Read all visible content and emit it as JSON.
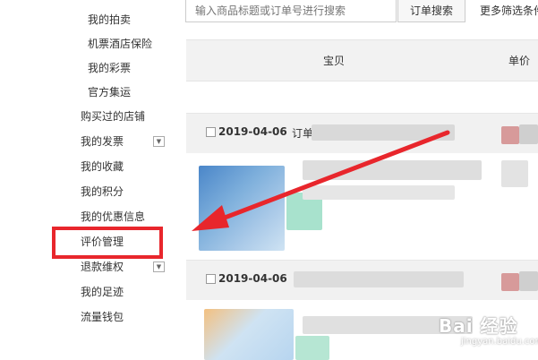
{
  "sidebar": {
    "sub_items": [
      {
        "label": "我的拍卖"
      },
      {
        "label": "机票酒店保险"
      },
      {
        "label": "我的彩票"
      },
      {
        "label": "官方集运"
      }
    ],
    "items": [
      {
        "label": "购买过的店铺"
      },
      {
        "label": "我的发票"
      },
      {
        "label": "我的收藏"
      },
      {
        "label": "我的积分"
      },
      {
        "label": "我的优惠信息"
      },
      {
        "label": "评价管理"
      },
      {
        "label": "退款维权"
      },
      {
        "label": "我的足迹"
      },
      {
        "label": "流量钱包"
      }
    ]
  },
  "search": {
    "placeholder": "输入商品标题或订单号进行搜索",
    "button_label": "订单搜索",
    "more_filters_label": "更多筛选条件"
  },
  "table_header": {
    "col_item": "宝贝",
    "col_price": "单价"
  },
  "orders": [
    {
      "date": "2019-04-06",
      "number_prefix": "订单"
    },
    {
      "date": "2019-04-06"
    }
  ],
  "watermark": {
    "brand": "Bai 经验",
    "sub": "jingyan.baidu.com"
  },
  "colors": {
    "highlight": "#e8262c",
    "arrow": "#e8262c",
    "header_bg": "#f2f2f2"
  }
}
